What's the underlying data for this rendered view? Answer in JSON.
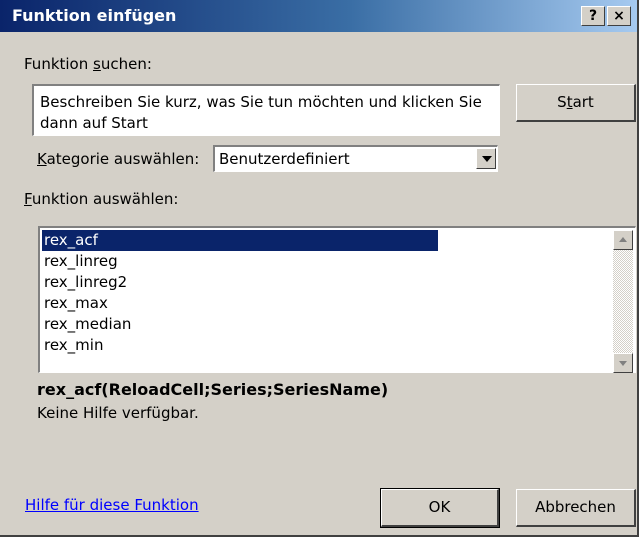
{
  "dialog": {
    "title": "Funktion einfügen",
    "help_button": "?",
    "close_button": "×"
  },
  "search": {
    "label_prefix": "Funktion ",
    "label_accel": "s",
    "label_suffix": "uchen:",
    "text": "Beschreiben Sie kurz, was Sie tun möchten und klicken Sie dann auf Start",
    "start_prefix": "S",
    "start_accel": "t",
    "start_suffix": "art"
  },
  "category": {
    "label_accel": "K",
    "label_rest": "ategorie auswählen:",
    "selected": "Benutzerdefiniert"
  },
  "functions": {
    "label_accel": "F",
    "label_rest": "unktion auswählen:",
    "items": [
      "rex_acf",
      "rex_linreg",
      "rex_linreg2",
      "rex_max",
      "rex_median",
      "rex_min"
    ],
    "selected_index": 0
  },
  "details": {
    "signature": "rex_acf(ReloadCell;Series;SeriesName)",
    "description": "Keine Hilfe verfügbar."
  },
  "footer": {
    "help_link": "Hilfe für diese Funktion",
    "ok": "OK",
    "cancel": "Abbrechen"
  },
  "colors": {
    "title_start": "#0a246a",
    "title_end": "#a6caf0",
    "selection": "#0a246a",
    "link": "#0000ff",
    "face": "#d4d0c8"
  },
  "icons": {
    "combo_arrow": "chevron-down-icon",
    "scroll_up": "arrow-up-icon",
    "scroll_down": "arrow-down-icon"
  }
}
